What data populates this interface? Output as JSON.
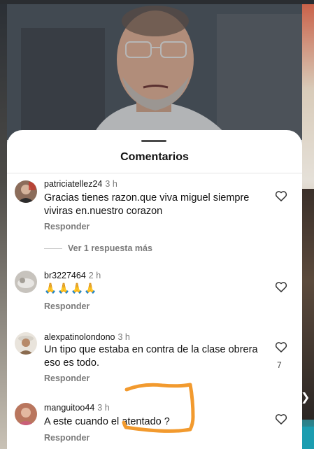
{
  "sheet": {
    "title": "Comentarios"
  },
  "comments": [
    {
      "username": "patriciatellez24",
      "time": "3 h",
      "text_line1": "Gracias tienes razon.que viva miguel siempre",
      "text_line2": "viviras en.nuestro corazon",
      "reply_label": "Responder",
      "view_replies_label": "Ver 1 respuesta más"
    },
    {
      "username": "br3227464",
      "time": "2 h",
      "text": "🙏🙏🙏🙏",
      "reply_label": "Responder"
    },
    {
      "username": "alexpatinolondono",
      "time": "3 h",
      "text_line1": "Un tipo que estaba en contra de la clase obrera",
      "text_line2": "eso es todo.",
      "reply_label": "Responder",
      "like_count": "7"
    },
    {
      "username": "manguitoo44",
      "time": "3 h",
      "text": "A este cuando el atentado ?",
      "reply_label": "Responder"
    }
  ],
  "icons": {
    "like": "heart-outline-icon",
    "next": "chevron-right-icon"
  },
  "colors": {
    "annotation": "#f29a2e",
    "secondary_text": "#7a7a7a",
    "teal_edge": "#1c9db0"
  }
}
